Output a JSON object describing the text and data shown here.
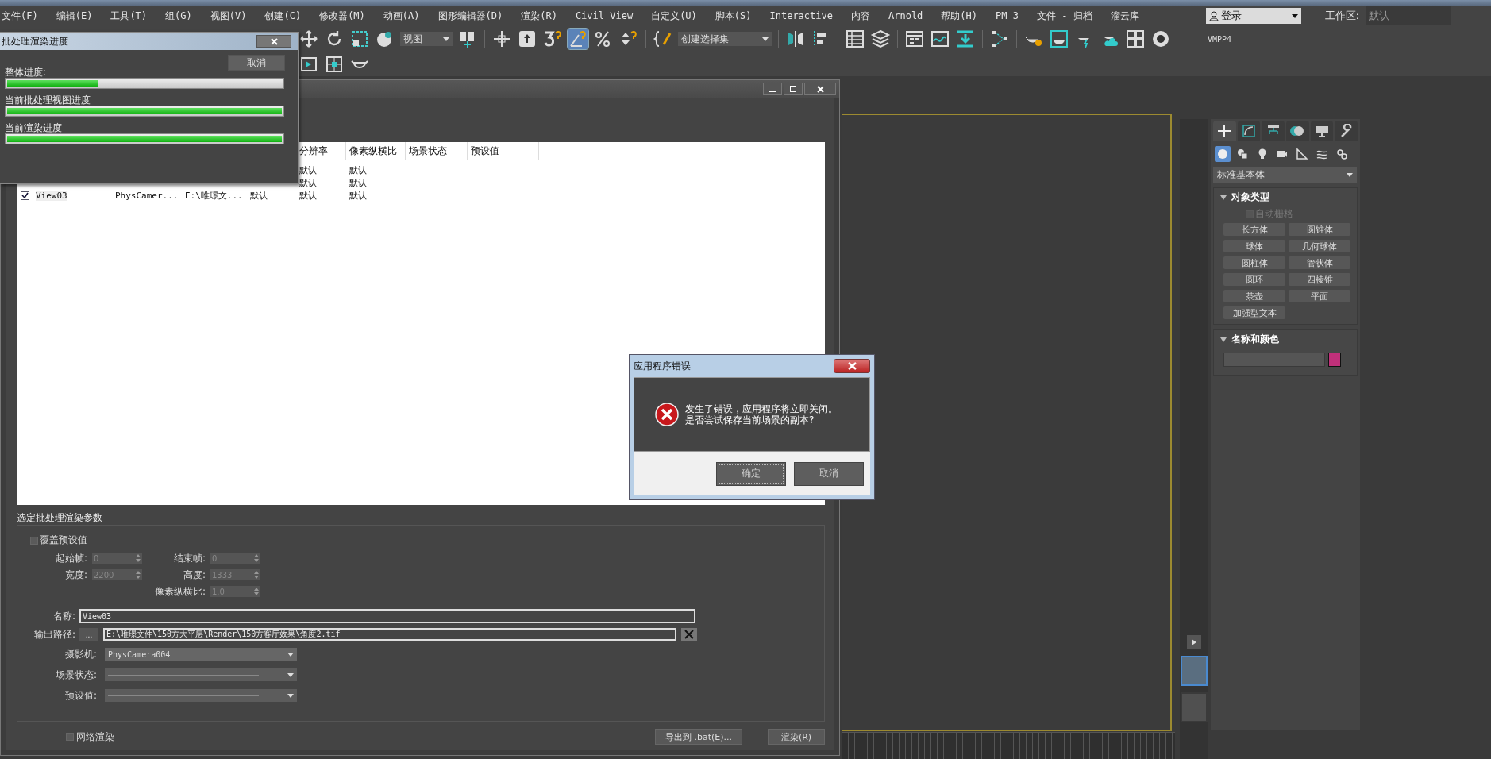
{
  "menu_bar": {
    "items": [
      "文件(F)",
      "编辑(E)",
      "工具(T)",
      "组(G)",
      "视图(V)",
      "创建(C)",
      "修改器(M)",
      "动画(A)",
      "图形编辑器(D)",
      "渲染(R)",
      "Civil View",
      "自定义(U)",
      "脚本(S)",
      "Interactive",
      "内容",
      "Arnold",
      "帮助(H)",
      "PM 3",
      "文件 - 归档",
      "溜云库"
    ]
  },
  "user_menu": {
    "label": "登录"
  },
  "workspace": {
    "label": "工作区:",
    "value": "默认"
  },
  "toolbar": {
    "dropdowns": [
      "视图",
      "创建选择集"
    ],
    "angle_snap": {
      "selected": true
    },
    "label": "VMPP4"
  },
  "command_panel": {
    "tabs": [
      {
        "selected": true
      },
      {
        "selected": false
      },
      {
        "selected": false
      },
      {
        "selected": false
      },
      {
        "selected": false
      },
      {
        "selected": false
      }
    ],
    "categories": [
      {
        "selected": true
      },
      {
        "selected": false
      },
      {
        "selected": false
      },
      {
        "selected": false
      },
      {
        "selected": false
      },
      {
        "selected": false
      },
      {
        "selected": false
      }
    ],
    "dropdown": "标准基本体",
    "object_type": {
      "title": "对象类型",
      "expanded": true,
      "autogrid": {
        "label": "自动栅格",
        "checked": false
      },
      "buttons": [
        "长方体",
        "圆锥体",
        "球体",
        "几何球体",
        "圆柱体",
        "管状体",
        "圆环",
        "四棱锥",
        "茶壶",
        "平面",
        "加强型文本"
      ]
    },
    "name_color": {
      "title": "名称和颜色",
      "expanded": true,
      "color": "#c0307a"
    }
  },
  "progress_dialog": {
    "title": "批处理渲染进度",
    "cancel": "取消",
    "bars": [
      {
        "label": "整体进度:",
        "level": 0.33
      },
      {
        "label": "当前批处理视图进度",
        "level": 1
      },
      {
        "label": "当前渲染进度",
        "level": 1
      }
    ]
  },
  "batch_render": {
    "table": {
      "columns": [
        "分辨率",
        "像素纵横比",
        "场景状态",
        "预设值"
      ],
      "rows": [
        {
          "resolution": "默认",
          "pixel_aspect": "默认"
        },
        {
          "resolution": "默认",
          "pixel_aspect": "默认"
        },
        {
          "checked": true,
          "column_1": "View03",
          "column_2": "PhysCamer...",
          "column_3": "E:\\唯璟文...",
          "column_4": "默认",
          "resolution": "默认",
          "pixel_aspect": "默认"
        }
      ]
    },
    "params": {
      "title": "选定批处理渲染参数",
      "override": {
        "label": "覆盖预设值",
        "checked": false
      },
      "start_frame": {
        "label": "起始帧:",
        "value": "0",
        "disabled": true
      },
      "end_frame": {
        "label": "结束帧:",
        "value": "0",
        "disabled": true
      },
      "width": {
        "label": "宽度:",
        "value": "2200",
        "disabled": true
      },
      "height": {
        "label": "高度:",
        "value": "1333",
        "disabled": true
      },
      "pixel_aspect": {
        "label": "像素纵横比:",
        "value": "1.0",
        "disabled": true
      },
      "name": {
        "label": "名称:",
        "value": "View03"
      },
      "output_path": {
        "label": "输出路径:",
        "browse": "...",
        "value": "E:\\唯璟文件\\150方大平层\\Render\\150方客厅效果\\角度2.tif"
      },
      "camera": {
        "label": "摄影机:",
        "value": "PhysCamera004"
      },
      "scene_state": {
        "label": "场景状态:"
      },
      "preset": {
        "label": "预设值:"
      }
    },
    "net_render": {
      "label": "网络渲染",
      "checked": false
    },
    "export_button": "导出到 .bat(E)...",
    "render_button": "渲染(R)"
  },
  "error_dialog": {
    "title": "应用程序错误",
    "message_lines": [
      "发生了错误，应用程序将立即关闭。",
      "是否尝试保存当前场景的副本?"
    ],
    "buttons": [
      {
        "label": "确定",
        "selected": true
      },
      {
        "label": "取消",
        "selected": false
      }
    ]
  }
}
